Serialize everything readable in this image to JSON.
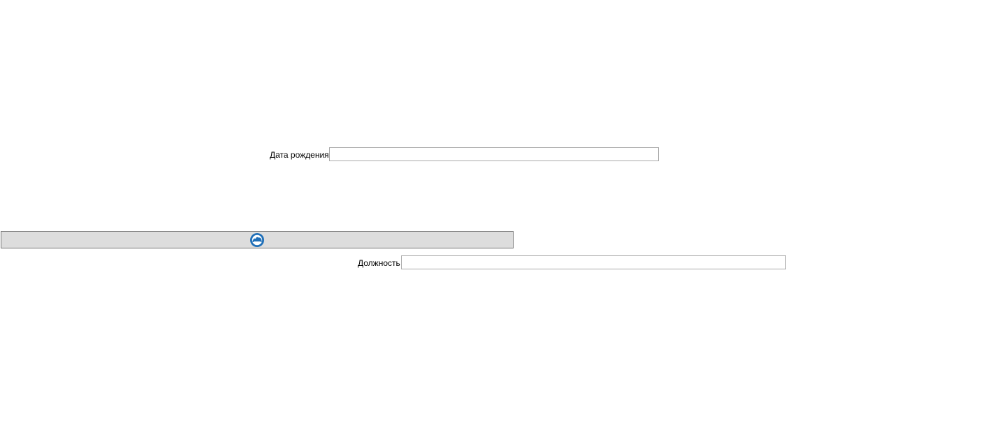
{
  "form": {
    "birth_date": {
      "label": "Дата рождения",
      "value": ""
    },
    "position": {
      "label": "Должность",
      "value": ""
    }
  },
  "toolbar": {
    "icon": "app-logo-icon",
    "accent_color": "#1f6fb8"
  }
}
